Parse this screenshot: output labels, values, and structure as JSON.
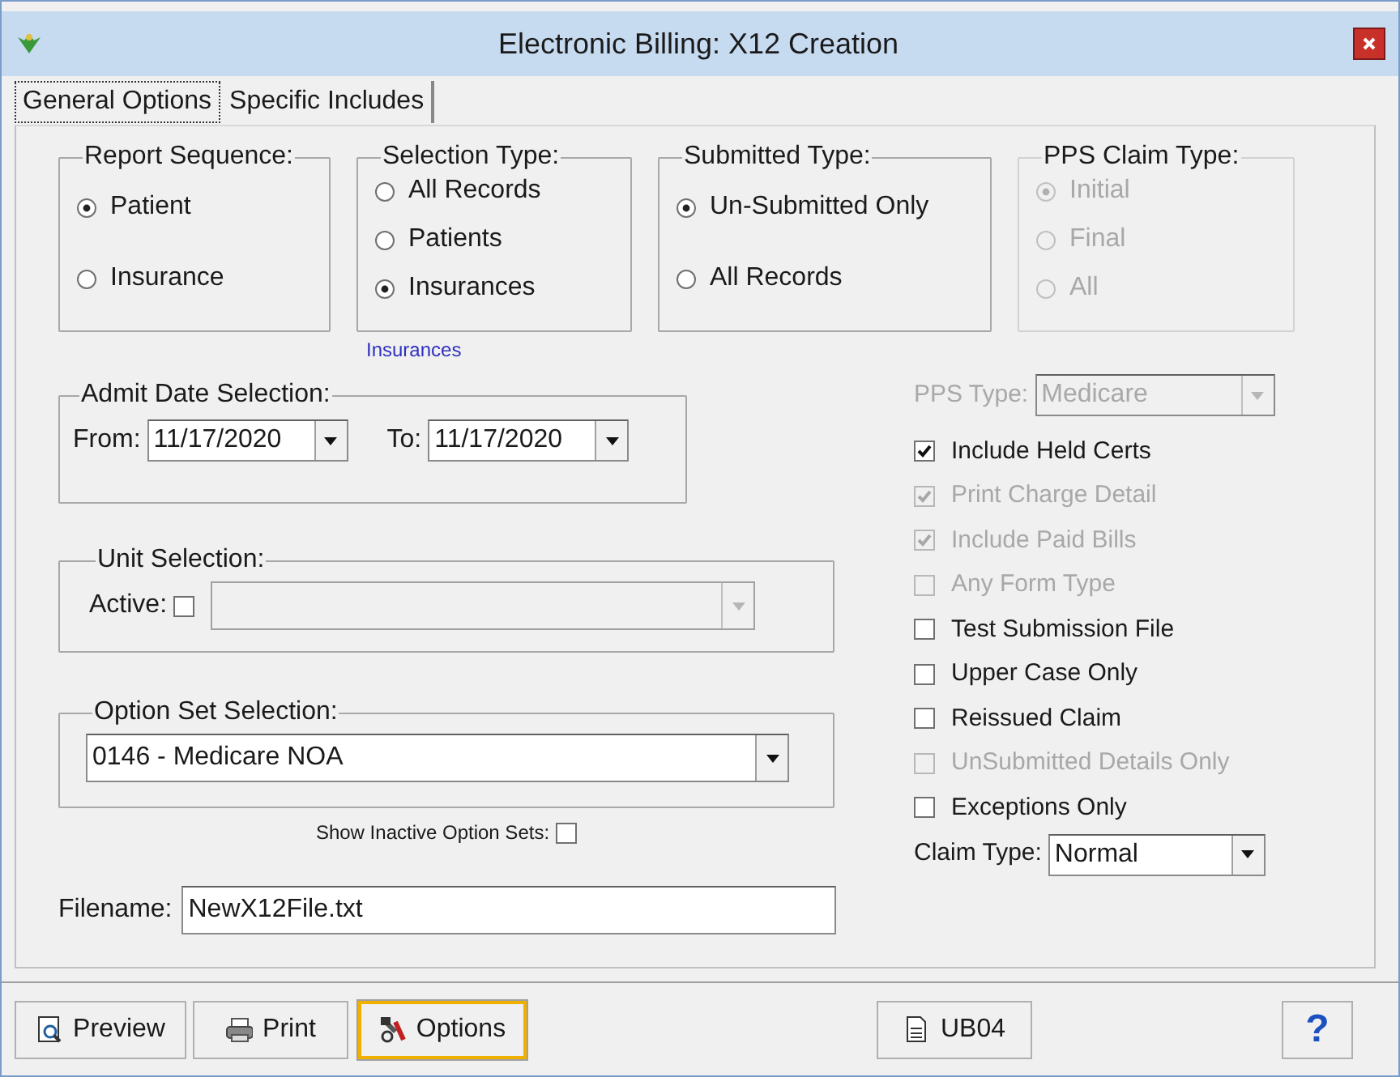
{
  "window": {
    "title": "Electronic Billing: X12 Creation"
  },
  "tabs": [
    {
      "label": "General Options",
      "selected": true
    },
    {
      "label": "Specific Includes",
      "selected": false
    }
  ],
  "radio_groups": [
    {
      "title": "Report Sequence:",
      "disabled": false,
      "options": [
        {
          "label": "Patient",
          "selected": true
        },
        {
          "label": "Insurance",
          "selected": false
        }
      ]
    },
    {
      "title": "Selection Type:",
      "disabled": false,
      "options": [
        {
          "label": "All Records",
          "selected": false
        },
        {
          "label": "Patients",
          "selected": false
        },
        {
          "label": "Insurances",
          "selected": true
        }
      ],
      "note": "Insurances"
    },
    {
      "title": "Submitted Type:",
      "disabled": false,
      "options": [
        {
          "label": "Un-Submitted Only",
          "selected": true
        },
        {
          "label": "All Records",
          "selected": false
        }
      ]
    },
    {
      "title": "PPS Claim Type:",
      "disabled": true,
      "options": [
        {
          "label": "Initial",
          "selected": true
        },
        {
          "label": "Final",
          "selected": false
        },
        {
          "label": "All",
          "selected": false
        }
      ]
    }
  ],
  "admit_date": {
    "title": "Admit Date Selection:",
    "from_label": "From:",
    "from_value": "11/17/2020",
    "to_label": "To:",
    "to_value": "11/17/2020"
  },
  "unit_selection": {
    "title": "Unit Selection:",
    "active_label": "Active:",
    "active_checked": false
  },
  "option_set": {
    "title": "Option Set Selection:",
    "value": "0146 - Medicare NOA",
    "show_inactive_label": "Show Inactive Option Sets:",
    "show_inactive_checked": false
  },
  "filename": {
    "label": "Filename:",
    "value": "NewX12File.txt"
  },
  "pps_type": {
    "label": "PPS Type:",
    "value": "Medicare",
    "disabled": true
  },
  "checkboxes": [
    {
      "label": "Include Held Certs",
      "checked": true,
      "disabled": false
    },
    {
      "label": "Print Charge Detail",
      "checked": true,
      "disabled": true
    },
    {
      "label": "Include Paid Bills",
      "checked": true,
      "disabled": true
    },
    {
      "label": "Any Form Type",
      "checked": false,
      "disabled": true
    },
    {
      "label": "Test Submission File",
      "checked": false,
      "disabled": false
    },
    {
      "label": "Upper Case Only",
      "checked": false,
      "disabled": false
    },
    {
      "label": "Reissued Claim",
      "checked": false,
      "disabled": false
    },
    {
      "label": "UnSubmitted Details Only",
      "checked": false,
      "disabled": true
    },
    {
      "label": "Exceptions Only",
      "checked": false,
      "disabled": false
    }
  ],
  "claim_type": {
    "label": "Claim Type:",
    "value": "Normal"
  },
  "buttons": [
    {
      "kind": "preview",
      "label": "Preview",
      "highlighted": false
    },
    {
      "kind": "print",
      "label": "Print",
      "highlighted": false
    },
    {
      "kind": "options",
      "label": "Options",
      "highlighted": true
    },
    {
      "kind": "ub04",
      "label": "UB04",
      "highlighted": false
    },
    {
      "kind": "help",
      "label": "?",
      "highlighted": false
    }
  ]
}
